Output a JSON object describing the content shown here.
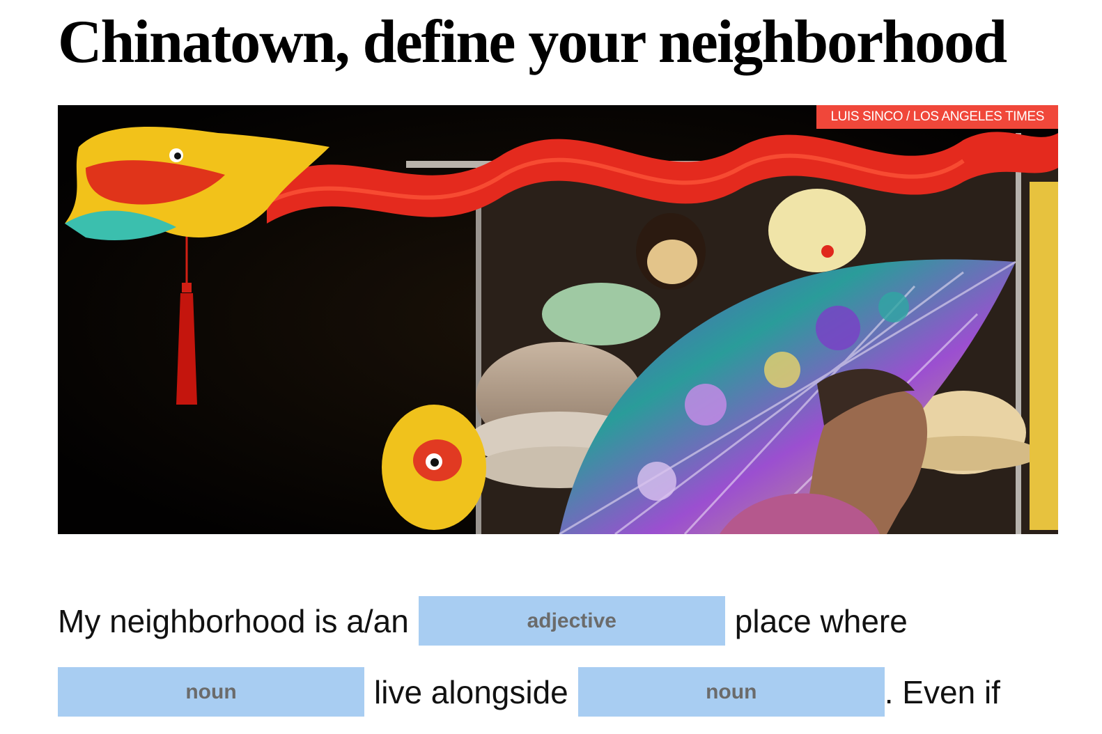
{
  "headline": "Chinatown, define your neighborhood",
  "photo": {
    "credit": "LUIS SINCO / LOS ANGELES TIMES"
  },
  "madlib": {
    "line1": {
      "before": "My neighborhood is a/an",
      "blank1_placeholder": "adjective",
      "after": "place where"
    },
    "line2": {
      "blank2_placeholder": "noun",
      "middle": "live alongside",
      "blank3_placeholder": "noun",
      "after": ". Even if"
    }
  }
}
